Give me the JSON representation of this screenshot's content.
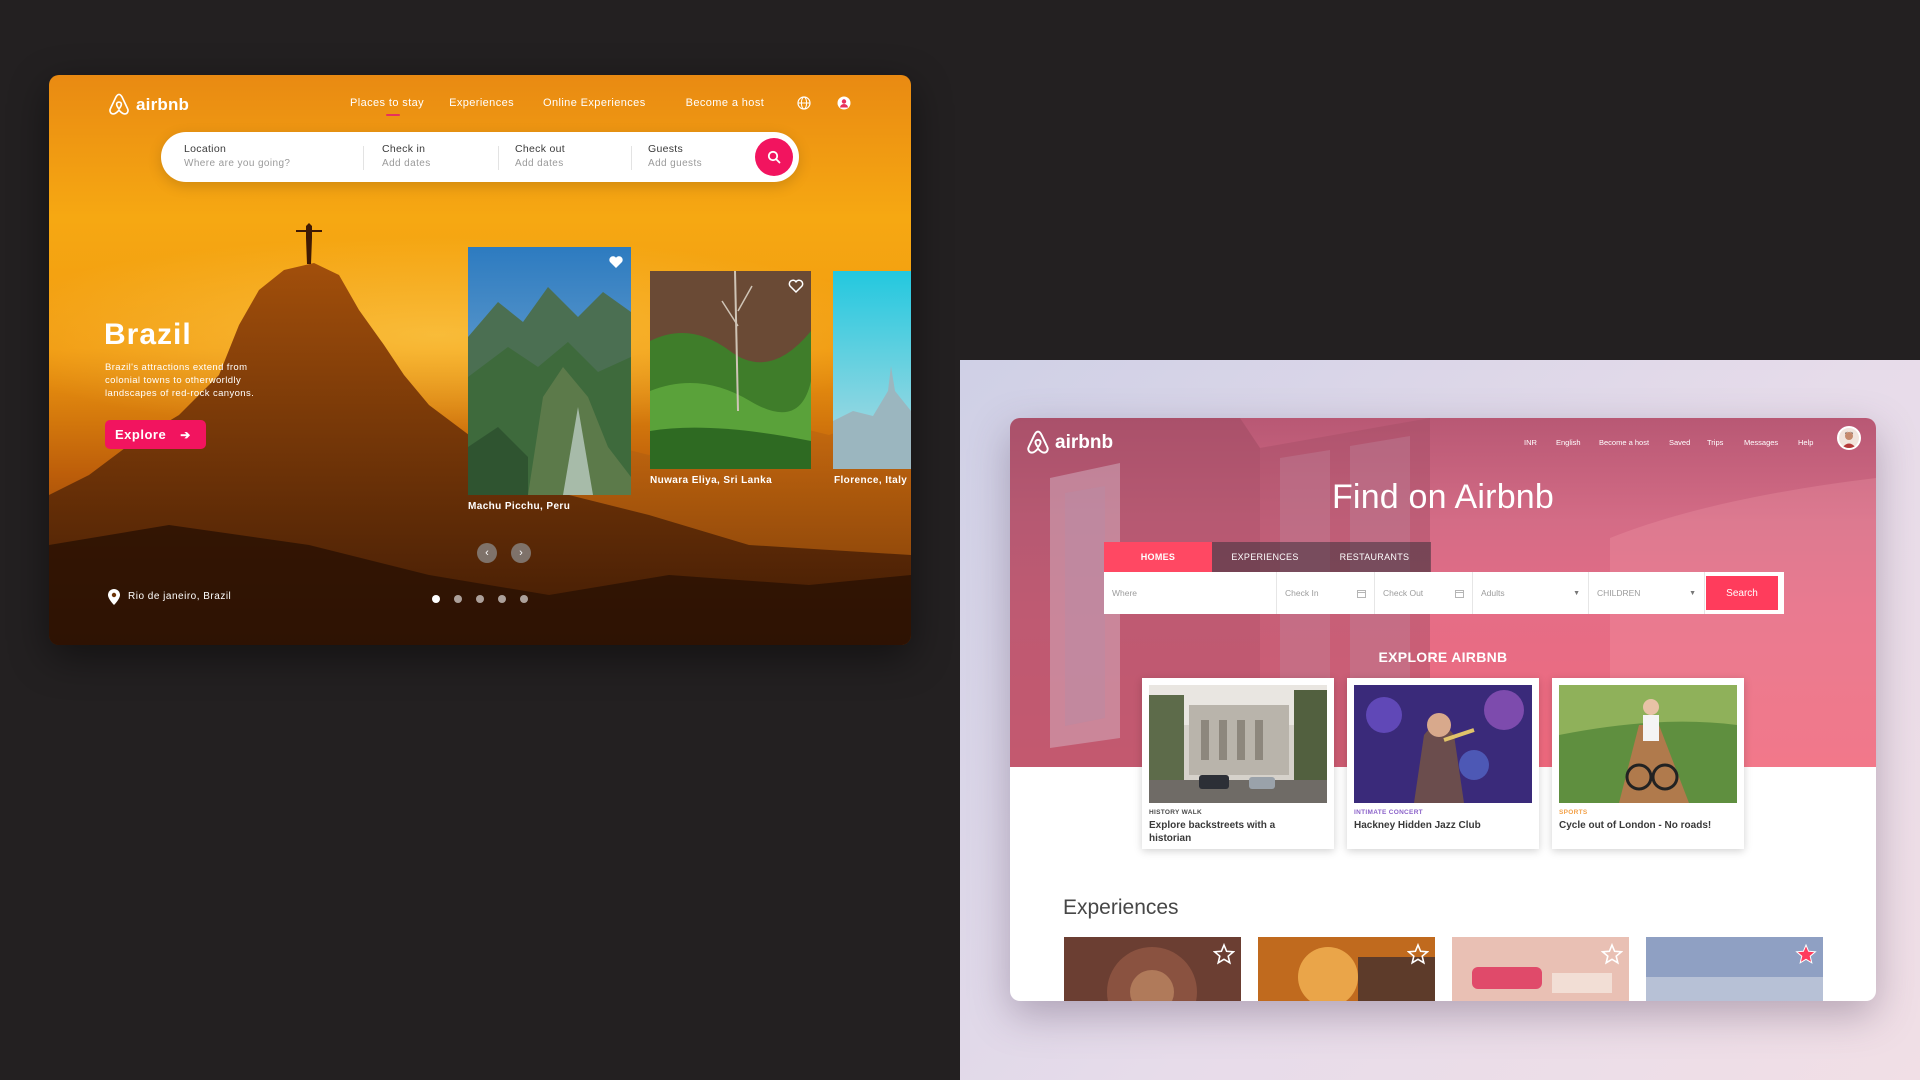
{
  "left_mockup": {
    "brand": "airbnb",
    "nav": [
      "Places to stay",
      "Experiences",
      "Online Experiences",
      "Become a host"
    ],
    "search": {
      "fields": [
        {
          "label": "Location",
          "placeholder": "Where are you going?"
        },
        {
          "label": "Check in",
          "placeholder": "Add dates"
        },
        {
          "label": "Check out",
          "placeholder": "Add dates"
        },
        {
          "label": "Guests",
          "placeholder": "Add guests"
        }
      ]
    },
    "hero": {
      "title": "Brazil",
      "description": "Brazil's attractions extend from colonial towns to otherworldly landscapes of red-rock canyons.",
      "cta": "Explore",
      "location": "Rio de janeiro, Brazil"
    },
    "cards": [
      "Machu Picchu, Peru",
      "Nuwara Eliya, Sri Lanka",
      "Florence, Italy"
    ],
    "carousel": {
      "pages": 5,
      "active": 1
    },
    "colors": {
      "accent": "#f2145f"
    }
  },
  "right_mockup": {
    "brand": "airbnb",
    "nav": [
      "INR",
      "English",
      "Become a host",
      "Saved",
      "Trips",
      "Messages",
      "Help"
    ],
    "headline": "Find on Airbnb",
    "tabs": [
      "HOMES",
      "EXPERIENCES",
      "RESTAURANTS"
    ],
    "active_tab": "HOMES",
    "search": {
      "where": "Where",
      "check_in": "Check In",
      "check_out": "Check Out",
      "adults": "Adults",
      "children": "CHILDREN",
      "button": "Search"
    },
    "explore_heading": "EXPLORE AIRBNB",
    "explore_cards": [
      {
        "category": "HISTORY WALK",
        "category_color": "#4a4a4a",
        "title": "Explore backstreets with a historian"
      },
      {
        "category": "INTIMATE CONCERT",
        "category_color": "#8b62c9",
        "title": "Hackney Hidden Jazz Club"
      },
      {
        "category": "SPORTS",
        "category_color": "#f3a24a",
        "title": "Cycle out of London - No roads!"
      }
    ],
    "experiences_heading": "Experiences",
    "colors": {
      "accent": "#ff3c5c"
    }
  }
}
